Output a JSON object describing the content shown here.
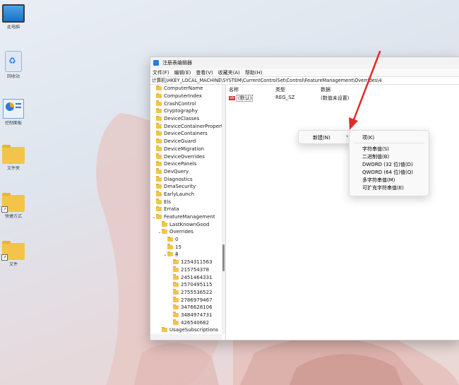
{
  "desktop": {
    "icons": [
      {
        "label": "此电脑",
        "icon": "monitor-icon"
      },
      {
        "label": "回收站",
        "icon": "recycle-bin-icon"
      },
      {
        "label": "控制面板",
        "icon": "control-panel-icon"
      },
      {
        "label": "文件夹",
        "icon": "folder-icon"
      },
      {
        "label": "快捷方式",
        "icon": "folder-shortcut-icon"
      },
      {
        "label": "文件",
        "icon": "folder-shortcut-icon"
      }
    ]
  },
  "window": {
    "title": "注册表编辑器",
    "menu": [
      "文件(F)",
      "编辑(E)",
      "查看(V)",
      "收藏夹(A)",
      "帮助(H)"
    ],
    "address": "计算机\\HKEY_LOCAL_MACHINE\\SYSTEM\\CurrentControlSet\\Control\\FeatureManagement\\Overrides\\4",
    "tree": [
      "ComputerName",
      "ComputerIndex",
      "CrashControl",
      "Cryptography",
      "DeviceClasses",
      "DeviceContainerPropertyUpda",
      "DeviceContainers",
      "DeviceGuard",
      "DeviceMigration",
      "DeviceOverrides",
      "DevicePanels",
      "DevQuery",
      "Diagnostics",
      "DmaSecurity",
      "EarlyLaunch",
      "Els",
      "Errata",
      "FeatureManagement",
      "LastKnownGood",
      "Overrides",
      "0",
      "15",
      "4",
      "1254311563",
      "215754378",
      "2451464331",
      "2570495115",
      "2755536522",
      "2786979467",
      "3476628106",
      "3484974731",
      "426540682",
      "UsageSubscriptions"
    ],
    "columns": {
      "name": "名称",
      "type": "类型",
      "data": "数据"
    },
    "value_row": {
      "name": "(默认)",
      "type": "REG_SZ",
      "data": "(数值未设置)",
      "icon": "string-value-icon"
    }
  },
  "context_menu": {
    "new_label": "新建(N)",
    "arrow": "›"
  },
  "submenu": {
    "items": [
      "项(K)",
      "字符串值(S)",
      "二进制值(B)",
      "DWORD (32 位)值(D)",
      "QWORD (64 位)值(Q)",
      "多字符串值(M)",
      "可扩充字符串值(E)"
    ]
  },
  "colors": {
    "accent": "#cce4f7",
    "arrow": "#e12b2b",
    "folder": "#f2c44b"
  }
}
